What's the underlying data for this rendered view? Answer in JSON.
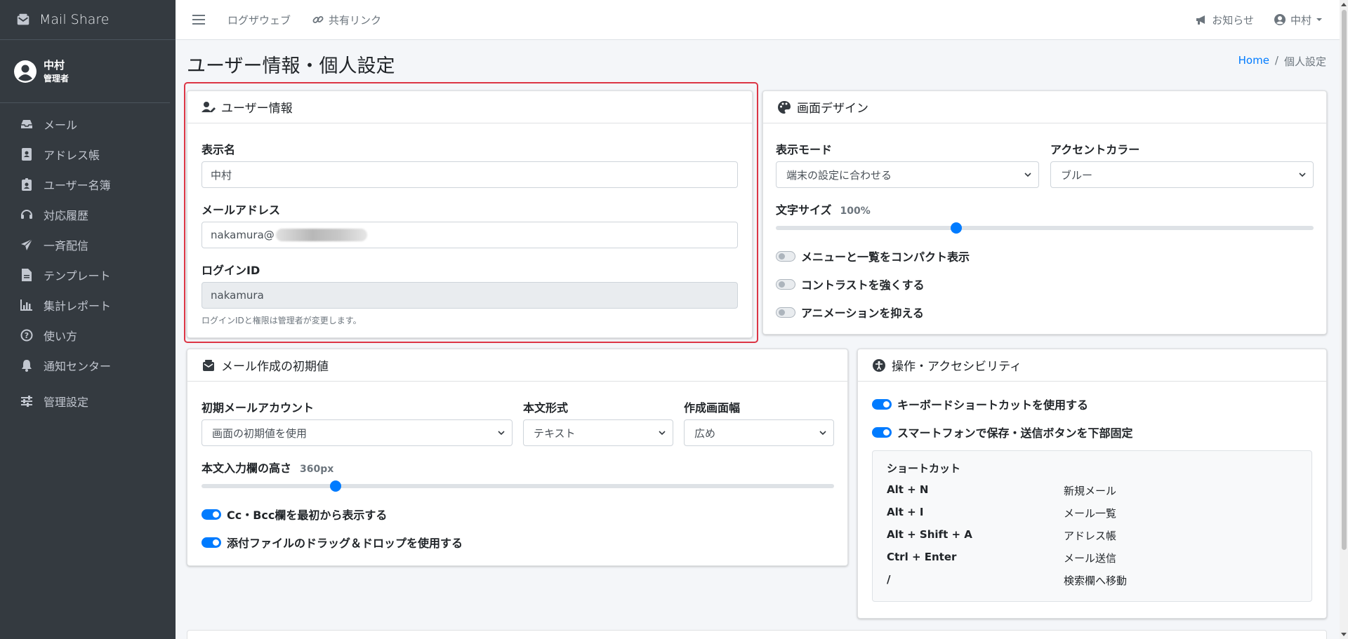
{
  "app": {
    "brand": "Mail Share"
  },
  "user_panel": {
    "name": "中村",
    "role": "管理者"
  },
  "sidebar": {
    "items": [
      {
        "label": "メール",
        "icon": "inbox-icon"
      },
      {
        "label": "アドレス帳",
        "icon": "address-book-icon"
      },
      {
        "label": "ユーザー名簿",
        "icon": "id-badge-icon"
      },
      {
        "label": "対応履歴",
        "icon": "headset-icon"
      },
      {
        "label": "一斉配信",
        "icon": "paper-plane-icon"
      },
      {
        "label": "テンプレート",
        "icon": "file-icon"
      },
      {
        "label": "集計レポート",
        "icon": "chart-icon"
      },
      {
        "label": "使い方",
        "icon": "help-icon"
      },
      {
        "label": "通知センター",
        "icon": "bell-icon"
      },
      {
        "label": "管理設定",
        "icon": "sliders-icon"
      }
    ]
  },
  "topbar": {
    "links": [
      "ログザウェブ",
      "共有リンク"
    ],
    "notice": "お知らせ",
    "user": "中村"
  },
  "page": {
    "title": "ユーザー情報・個人設定",
    "breadcrumb": {
      "home": "Home",
      "separator": "/",
      "current": "個人設定"
    }
  },
  "user_info": {
    "header": "ユーザー情報",
    "display_name_label": "表示名",
    "display_name_value": "中村",
    "email_label": "メールアドレス",
    "email_value": "nakamura@",
    "login_id_label": "ログインID",
    "login_id_value": "nakamura",
    "hint": "ログインIDと権限は管理者が変更します。"
  },
  "design": {
    "header": "画面デザイン",
    "display_mode_label": "表示モード",
    "display_mode_value": "端末の設定に合わせる",
    "accent_label": "アクセントカラー",
    "accent_value": "ブルー",
    "font_size_label": "文字サイズ",
    "font_size_value": "100%",
    "font_size_level": 0.336,
    "toggles": [
      {
        "label": "メニューと一覧をコンパクト表示",
        "on": false
      },
      {
        "label": "コントラストを強くする",
        "on": false
      },
      {
        "label": "アニメーションを抑える",
        "on": false
      }
    ]
  },
  "compose": {
    "header": "メール作成の初期値",
    "account_label": "初期メールアカウント",
    "account_value": "画面の初期値を使用",
    "format_label": "本文形式",
    "format_value": "テキスト",
    "width_label": "作成画面幅",
    "width_value": "広め",
    "height_label": "本文入力欄の高さ",
    "height_value": "360px",
    "height_level": 0.212,
    "toggles": [
      {
        "label": "Cc・Bcc欄を最初から表示する",
        "on": true
      },
      {
        "label": "添付ファイルのドラッグ＆ドロップを使用する",
        "on": true
      }
    ]
  },
  "access": {
    "header": "操作・アクセシビリティ",
    "toggles": [
      {
        "label": "キーボードショートカットを使用する",
        "on": true
      },
      {
        "label": "スマートフォンで保存・送信ボタンを下部固定",
        "on": true
      }
    ],
    "shortcut_title": "ショートカット",
    "shortcuts": [
      {
        "key": "Alt + N",
        "desc": "新規メール"
      },
      {
        "key": "Alt + I",
        "desc": "メール一覧"
      },
      {
        "key": "Alt + Shift + A",
        "desc": "アドレス帳"
      },
      {
        "key": "Ctrl + Enter",
        "desc": "メール送信"
      },
      {
        "key": "/",
        "desc": "検索欄へ移動"
      }
    ]
  },
  "colors": {
    "sidebar_bg": "#343a40",
    "accent": "#007bff",
    "highlight": "#dc3545"
  }
}
